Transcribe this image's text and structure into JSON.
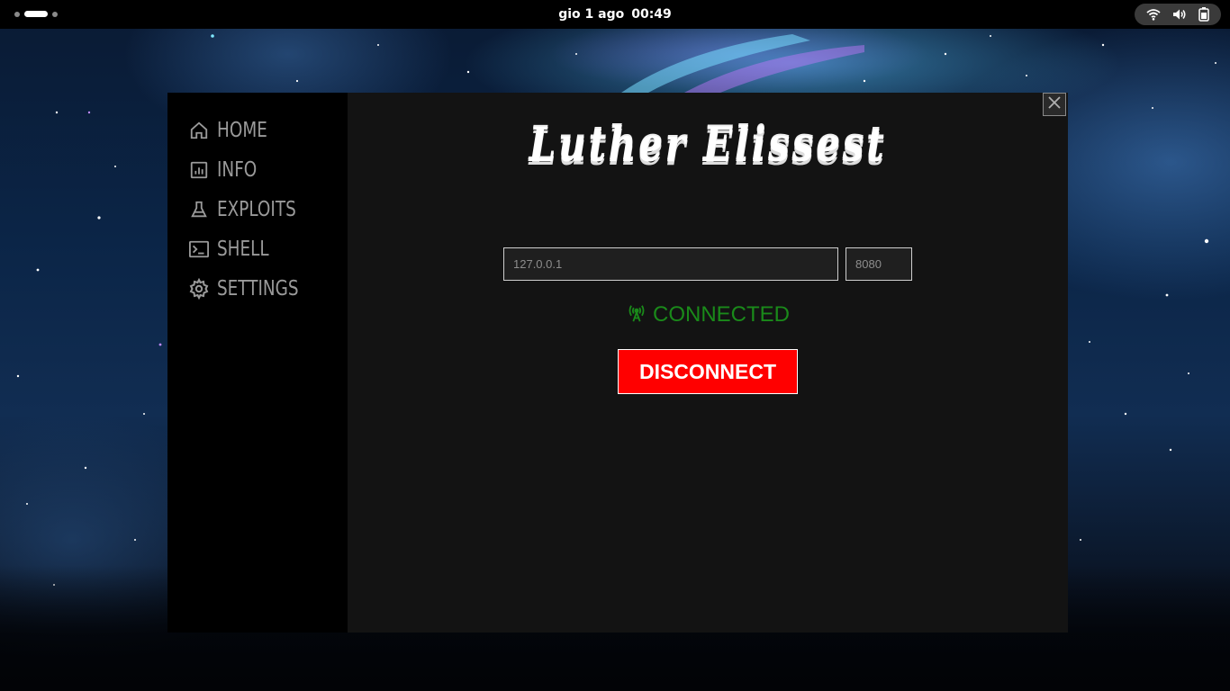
{
  "topbar": {
    "date": "gio 1 ago",
    "time": "00:49",
    "tray_icons": [
      "wifi-icon",
      "volume-icon",
      "battery-icon"
    ]
  },
  "app": {
    "title_logo": "Luther Elissest",
    "nav": [
      {
        "label": "HOME",
        "icon": "home-icon"
      },
      {
        "label": "INFO",
        "icon": "chart-icon"
      },
      {
        "label": "EXPLOITS",
        "icon": "flask-icon"
      },
      {
        "label": "SHELL",
        "icon": "terminal-icon"
      },
      {
        "label": "SETTINGS",
        "icon": "gear-icon"
      }
    ],
    "connection": {
      "ip_value": "127.0.0.1",
      "port_value": "8080",
      "status": "CONNECTED",
      "button_label": "DISCONNECT"
    },
    "colors": {
      "status_green": "#1a8a1a",
      "button_red": "#ff0000",
      "sidebar_bg": "#000000",
      "content_bg": "#131313"
    }
  }
}
